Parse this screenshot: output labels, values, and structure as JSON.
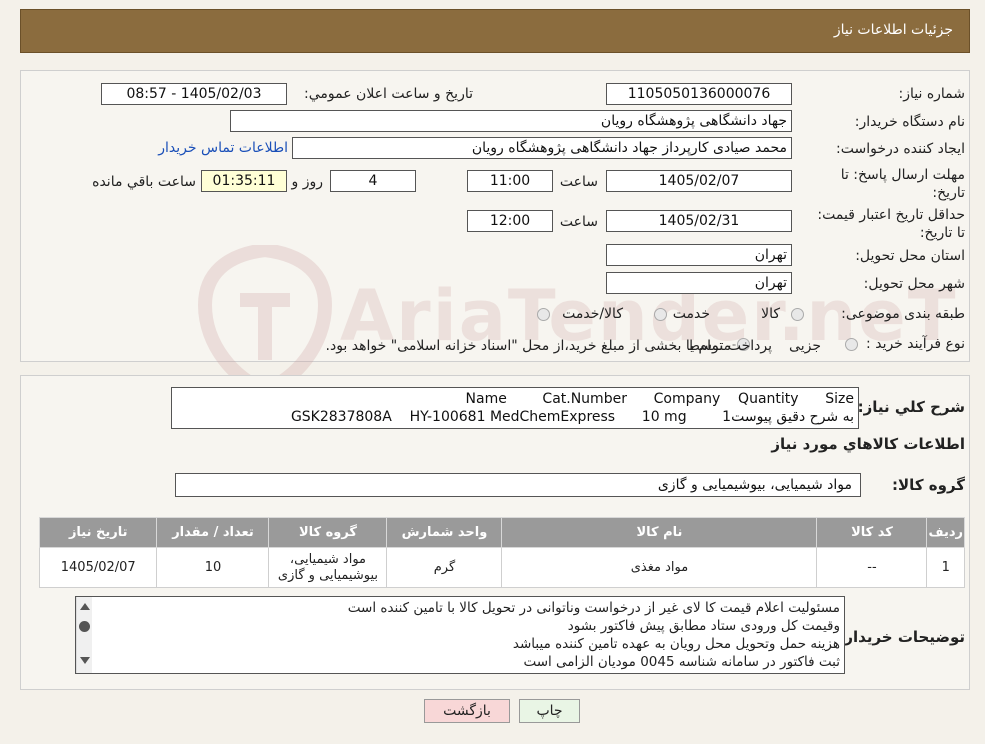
{
  "header": {
    "title": "جزئیات اطلاعات نیاز"
  },
  "general": {
    "need_number_label": "شماره نیاز:",
    "need_number": "1105050136000076",
    "announce_label": "تاریخ و ساعت اعلان عمومي:",
    "announce_value": "1405/02/03 - 08:57",
    "buyer_org_label": "نام دستگاه خريدار:",
    "buyer_org": "جهاد دانشگاهی پژوهشگاه رویان",
    "creator_label": "ايجاد کننده درخواست:",
    "creator": "محمد صیادی کارپرداز جهاد دانشگاهی پژوهشگاه رویان",
    "contact_link": "اطلاعات تماس خريدار",
    "deadline_label": "مهلت ارسال پاسخ: تا تاریخ:",
    "deadline_date": "1405/02/07",
    "time_label": "ساعت",
    "deadline_time": "11:00",
    "days_value": "4",
    "days_label": "روز و",
    "remaining_value": "01:35:11",
    "remaining_label": "ساعت باقي مانده",
    "validity_label": "حداقل تاریخ اعتبار قیمت: تا تاریخ:",
    "validity_date": "1405/02/31",
    "validity_time": "12:00",
    "province_label": "استان محل تحویل:",
    "province": "تهران",
    "city_label": "شهر محل تحویل:",
    "city": "تهران",
    "category_label": "طبقه بندی موضوعی:",
    "category_options": [
      "کالا",
      "خدمت",
      "کالا/خدمت"
    ],
    "process_label": "نوع فرآیند خرید :",
    "process_options": [
      "جزیی",
      "متوسط"
    ],
    "process_note": "پرداخت تمام یا بخشی از مبلغ خرید،از محل \"اسناد خزانه اسلامی\" خواهد بود."
  },
  "summary": {
    "label": "شرح کلي نياز:",
    "line1": "Name        Cat.Number      Company    Quantity      Size",
    "line2": "GSK2837808A    HY-100681 MedChemExpress      10 mg        1به شرح دقیق پیوست"
  },
  "goods": {
    "title": "اطلاعات کالاهاي مورد نياز",
    "group_label": "گروه کالا:",
    "group_value": "مواد شیمیایی، بیوشیمیایی و  گازی",
    "columns": [
      "رديف",
      "کد کالا",
      "نام کالا",
      "واحد شمارش",
      "گروه کالا",
      "تعداد / مقدار",
      "تاریخ نیاز"
    ],
    "rows": [
      {
        "index": "1",
        "code": "--",
        "name": "مواد مغذی",
        "unit": "گرم",
        "group": "مواد شیمیایی، بیوشیمیایی و گازی",
        "qty": "10",
        "date": "1405/02/07"
      }
    ]
  },
  "buyer_notes": {
    "label": "توضيحات خريدار:",
    "lines": [
      "مسئولیت اعلام قیمت کا لای  غیر از درخواست وناتوانی در تحویل کالا با تامین کننده است",
      "وقیمت کل ورودی ستاد مطابق پیش فاکتور بشود",
      "هزینه حمل وتحویل محل رویان به عهده تامین کننده میباشد",
      "ثبت فاکتور در سامانه  شناسه 0045 مودیان الزامی است"
    ]
  },
  "buttons": {
    "print": "چاپ",
    "back": "بازگشت"
  },
  "watermark": "AriaTender.neT",
  "colors": {
    "header": "#8b6c3e",
    "table_header": "#9a9a9a",
    "link": "#1a4fb8"
  }
}
